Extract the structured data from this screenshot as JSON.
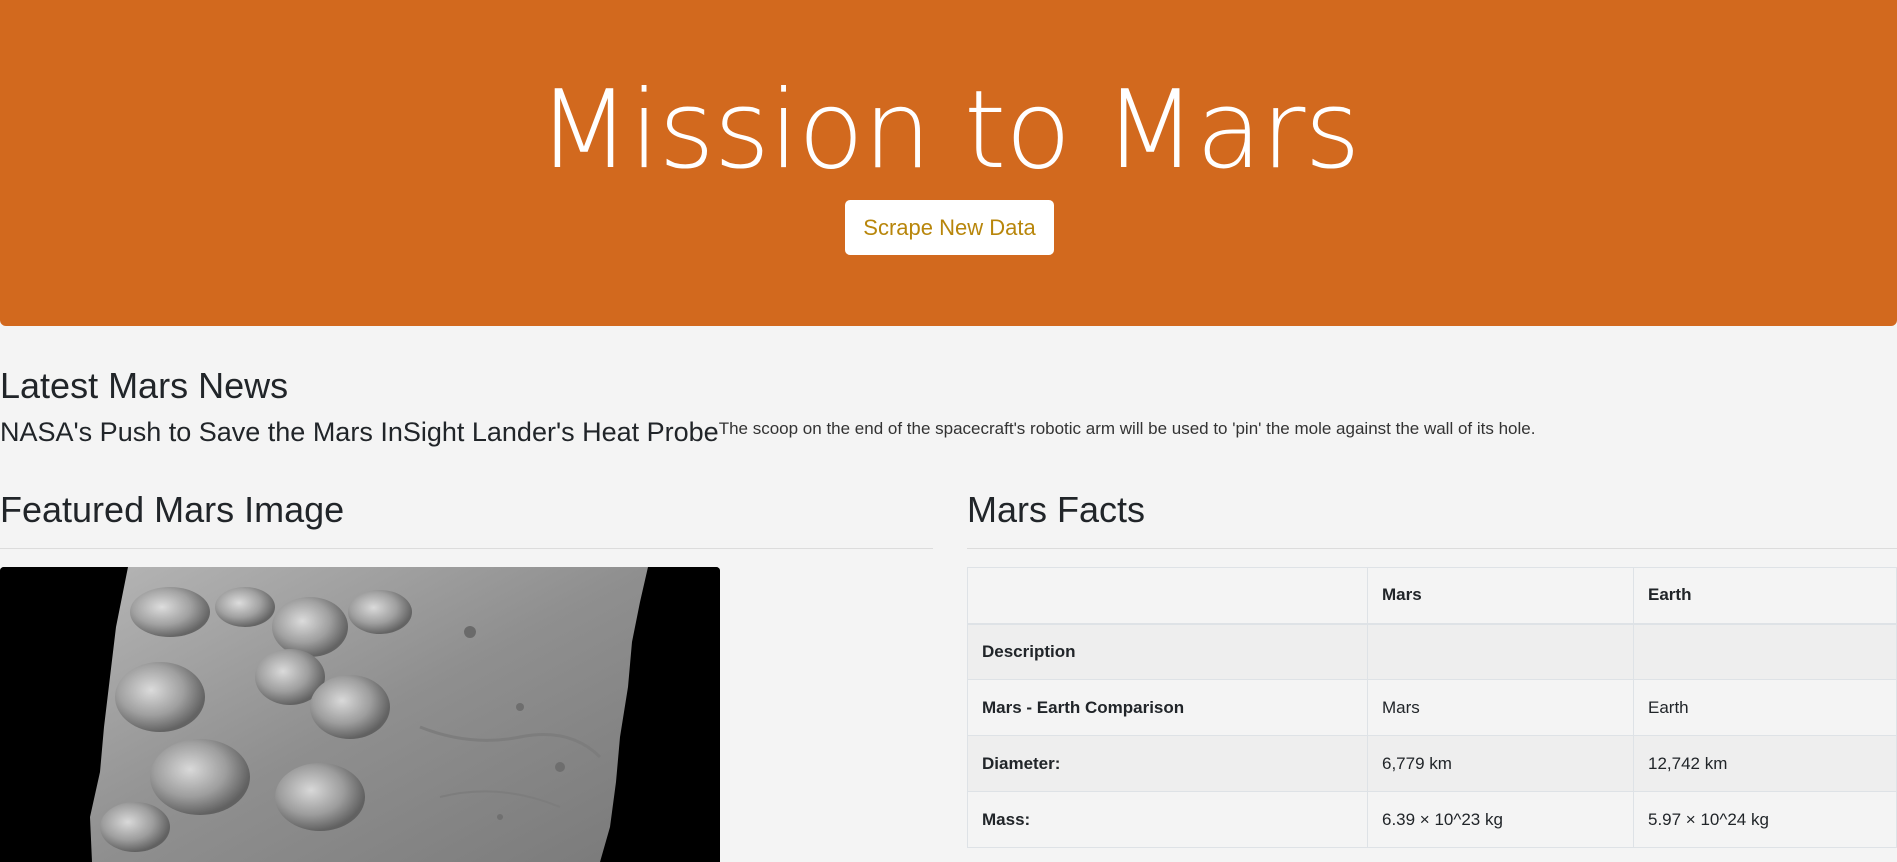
{
  "header": {
    "title": "Mission to Mars",
    "scrape_button_label": "Scrape New Data",
    "background_color": "#d2691e"
  },
  "news": {
    "section_title": "Latest Mars News",
    "headline": "NASA's Push to Save the Mars InSight Lander's Heat Probe",
    "teaser": "The scoop on the end of the spacecraft's robotic arm will be used to 'pin' the mole against the wall of its hole."
  },
  "featured_image": {
    "section_title": "Featured Mars Image"
  },
  "facts": {
    "section_title": "Mars Facts",
    "columns": [
      "",
      "Mars",
      "Earth"
    ],
    "rows": [
      {
        "label": "Description",
        "mars": "",
        "earth": ""
      },
      {
        "label": "Mars - Earth Comparison",
        "mars": "Mars",
        "earth": "Earth"
      },
      {
        "label": "Diameter:",
        "mars": "6,779 km",
        "earth": "12,742 km"
      },
      {
        "label": "Mass:",
        "mars": "6.39 × 10^23 kg",
        "earth": "5.97 × 10^24 kg"
      }
    ]
  }
}
